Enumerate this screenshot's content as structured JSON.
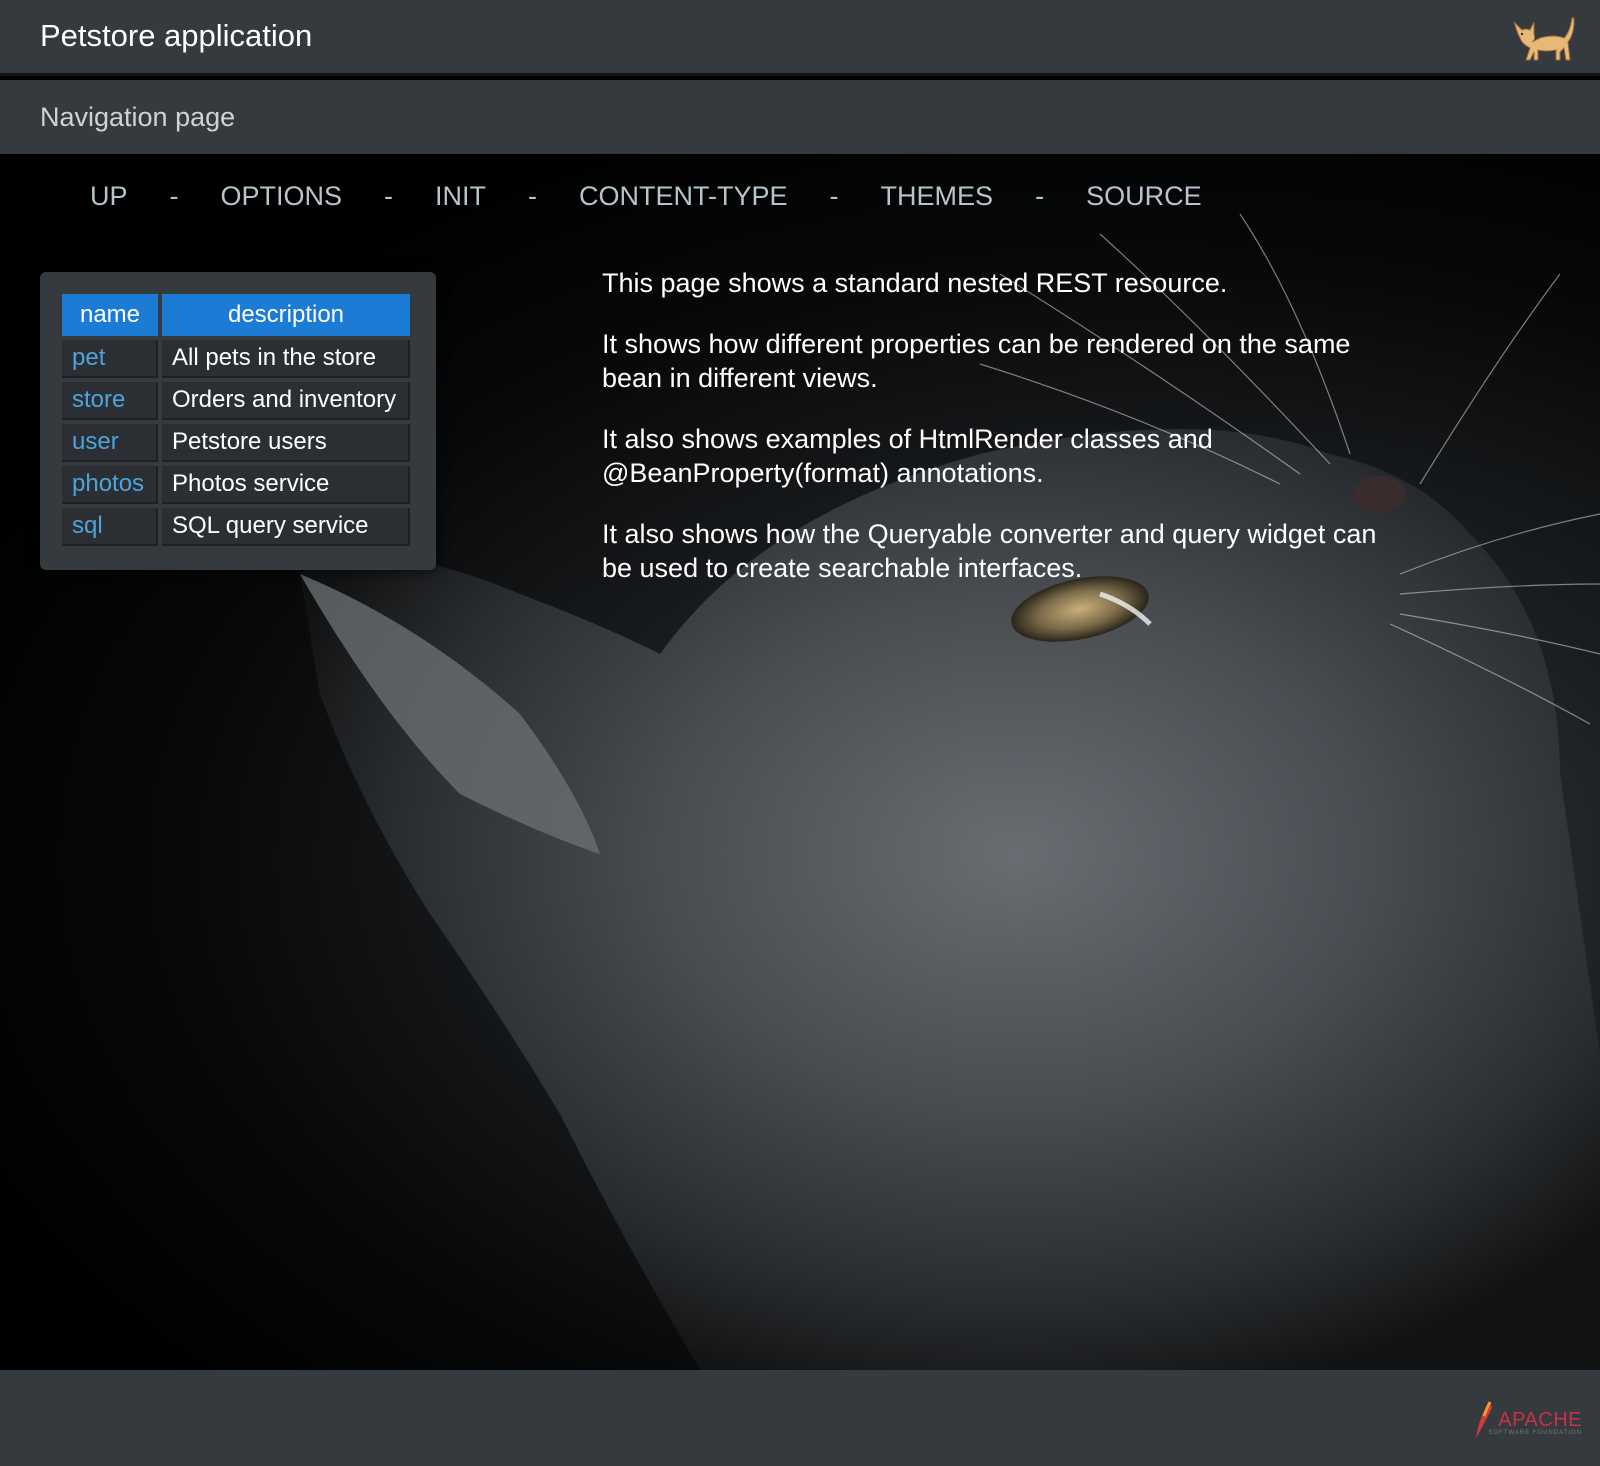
{
  "header": {
    "title": "Petstore application",
    "logo_icon": "cat-icon"
  },
  "subheader": {
    "title": "Navigation page"
  },
  "nav": {
    "links": [
      "UP",
      "OPTIONS",
      "INIT",
      "CONTENT-TYPE",
      "THEMES",
      "SOURCE"
    ],
    "separator": "-"
  },
  "table": {
    "headers": [
      "name",
      "description"
    ],
    "rows": [
      {
        "name": "pet",
        "description": "All pets in the store"
      },
      {
        "name": "store",
        "description": "Orders and inventory"
      },
      {
        "name": "user",
        "description": "Petstore users"
      },
      {
        "name": "photos",
        "description": "Photos service"
      },
      {
        "name": "sql",
        "description": "SQL query service"
      }
    ]
  },
  "description": {
    "paragraphs": [
      "This page shows a standard nested REST resource.",
      "It shows how different properties can be rendered on the same bean in different views.",
      "It also shows examples of HtmlRender classes and @BeanProperty(format) annotations.",
      "It also shows how the Queryable converter and query widget can be used to create searchable interfaces."
    ]
  },
  "footer": {
    "logo_text": "APACHE",
    "logo_subtext": "SOFTWARE FOUNDATION",
    "logo_icon": "apache-feather-icon"
  },
  "colors": {
    "header_bg": "#353a3f",
    "table_header_bg": "#1c7bd4",
    "link_color": "#4ea3dd",
    "nav_color": "#b6c4cc",
    "apache_red": "#c9314a"
  }
}
